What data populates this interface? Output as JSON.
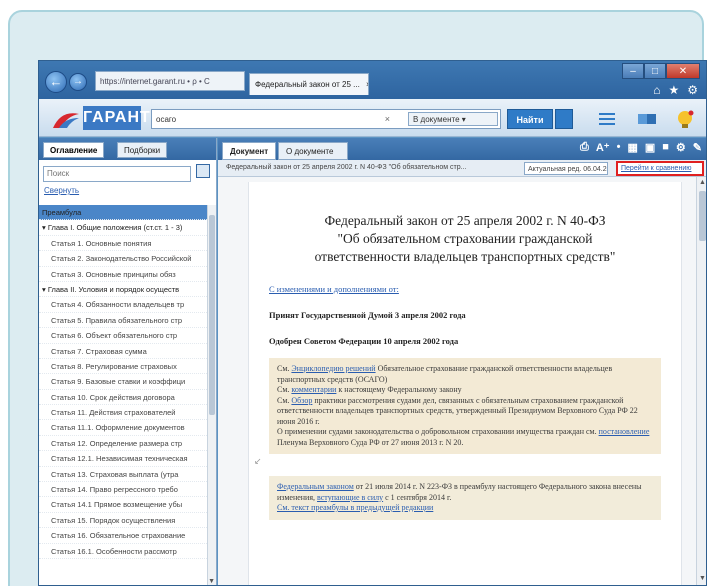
{
  "browser": {
    "address_host": "garant.ru",
    "address_text": "https://internet.garant.ru",
    "address_suffix": "• ρ • C",
    "tab_title": "Федеральный закон от 25 ...",
    "tab_close": "×",
    "icons": [
      "home-icon",
      "star-icon",
      "gear-icon"
    ]
  },
  "toolbar": {
    "logo_text": "ГАРАНТ",
    "search_value": "осаго",
    "search_clear": "×",
    "search_scope": "В документе",
    "search_button": "Найти"
  },
  "left_panel": {
    "tabs": [
      "Оглавление",
      "Подборки"
    ],
    "search_placeholder": "Поиск",
    "collapse_link": "Свернуть",
    "items": [
      {
        "text": "Преамбула",
        "selected": true,
        "level": 0
      },
      {
        "text": "▾ Глава I. Общие положения (ст.ст. 1 - 3)",
        "selected": false,
        "level": 0
      },
      {
        "text": "Статья 1. Основные понятия",
        "selected": false,
        "level": 1
      },
      {
        "text": "Статья 2. Законодательство Российской",
        "selected": false,
        "level": 1
      },
      {
        "text": "Статья 3. Основные принципы обяз",
        "selected": false,
        "level": 1
      },
      {
        "text": "▾ Глава II. Условия и порядок осуществ",
        "selected": false,
        "level": 0
      },
      {
        "text": "Статья 4. Обязанности владельцев тр",
        "selected": false,
        "level": 1
      },
      {
        "text": "Статья 5. Правила обязательного стр",
        "selected": false,
        "level": 1
      },
      {
        "text": "Статья 6. Объект обязательного стр",
        "selected": false,
        "level": 1
      },
      {
        "text": "Статья 7. Страховая сумма",
        "selected": false,
        "level": 1
      },
      {
        "text": "Статья 8. Регулирование страховых",
        "selected": false,
        "level": 1
      },
      {
        "text": "Статья 9. Базовые ставки и коэффици",
        "selected": false,
        "level": 1
      },
      {
        "text": "Статья 10. Срок действия договора",
        "selected": false,
        "level": 1
      },
      {
        "text": "Статья 11. Действия страхователей",
        "selected": false,
        "level": 1
      },
      {
        "text": "Статья 11.1. Оформление документов",
        "selected": false,
        "level": 1
      },
      {
        "text": "Статья 12. Определение размера стр",
        "selected": false,
        "level": 1
      },
      {
        "text": "Статья 12.1. Независимая техническая",
        "selected": false,
        "level": 1
      },
      {
        "text": "Статья 13. Страховая выплата (утра",
        "selected": false,
        "level": 1
      },
      {
        "text": "Статья 14. Право регрессного требо",
        "selected": false,
        "level": 1
      },
      {
        "text": "Статья 14.1 Прямое возмещение убы",
        "selected": false,
        "level": 1
      },
      {
        "text": "Статья 15. Порядок осуществления",
        "selected": false,
        "level": 1
      },
      {
        "text": "Статья 16. Обязательное страхование",
        "selected": false,
        "level": 1
      },
      {
        "text": "Статья 16.1. Особенности рассмотр",
        "selected": false,
        "level": 1
      }
    ]
  },
  "document": {
    "tabs": [
      "Документ",
      "О документе"
    ],
    "tools": "A⁺ •  ⎙ ⎙  ■ ⚙",
    "info_text": "Федеральный закон от 25 апреля 2002 г. N 40-ФЗ \"Об обязательном стр...",
    "edition_select": "Актуальная ред. 06.04.2015 ▾",
    "highlighted_link": "Перейти к сравнению",
    "title_lines": [
      "Федеральный закон от 25 апреля 2002 г. N 40-ФЗ",
      "\"Об обязательном страховании гражданской",
      "ответственности владельцев транспортных средств\""
    ],
    "changes_link": "С изменениями и дополнениями от:",
    "adopted": "Принят Государственной Думой 3 апреля 2002 года",
    "approved": "Одобрен Советом Федерации 10 апреля 2002 года",
    "note1": {
      "p1_pre": "См. ",
      "p1_link": "Энциклопедию решений",
      "p1_post": " Обязательное страхование гражданской ответственности владельцев транспортных средств (ОСАГО)",
      "p2_pre": "См. ",
      "p2_link": "комментарии",
      "p2_post": " к настоящему Федеральному закону",
      "p3_pre": "См. ",
      "p3_link": "Обзор",
      "p3_post": " практики рассмотрения судами дел, связанных с обязательным страхованием гражданской ответственности владельцев транспортных средств, утвержденный Президиумом Верховного Суда РФ 22 июня 2016 г.",
      "p4_pre": "О применении судами законодательства о добровольном страховании имущества граждан см. ",
      "p4_link": "постановление",
      "p4_post": " Пленума Верховного Суда РФ от 27 июня 2013 г. N 20."
    },
    "note2": {
      "p1_link": "Федеральным законом",
      "p1_mid": " от 21 июля 2014 г. N 223-ФЗ в преамбулу настоящего Федерального закона внесены изменения, ",
      "p1_link2": "вступающие в силу",
      "p1_post": " с 1 сентября 2014 г.",
      "p2_link": "См. текст преамбулы в предыдущей редакции"
    },
    "gutter_mark": "↙"
  },
  "colors": {
    "accent": "#3b79c4",
    "highlight_border": "#e02020",
    "note_bg": "#f3ead5",
    "selected_item": "#4a86c8"
  }
}
